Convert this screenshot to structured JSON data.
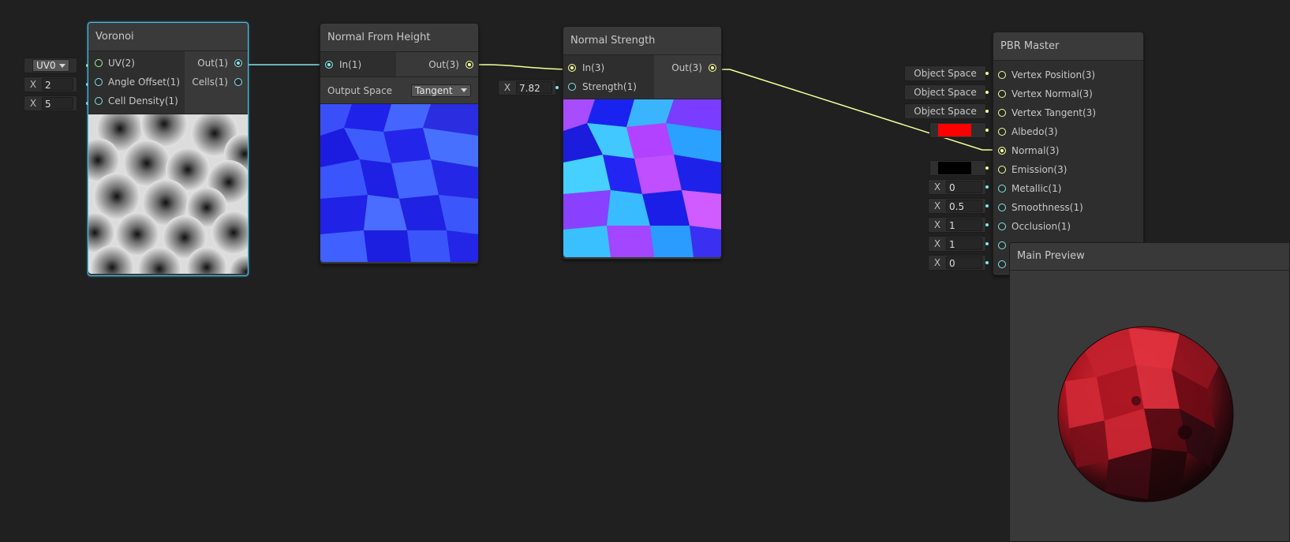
{
  "colors": {
    "background": "#202020",
    "node_body": "#393939",
    "selection": "#44c0e8",
    "wire_vector1": "#84e4e7",
    "wire_vector3": "#f6ff9a",
    "albedo": "#ff0000",
    "emission": "#000000"
  },
  "voronoi": {
    "title": "Voronoi",
    "inputs": [
      {
        "label": "UV(2)",
        "icon": "port-green"
      },
      {
        "label": "Angle Offset(1)",
        "icon": "port-cyan"
      },
      {
        "label": "Cell Density(1)",
        "icon": "port-cyan"
      }
    ],
    "outputs": [
      {
        "label": "Out(1)",
        "icon": "port-cyan-connected"
      },
      {
        "label": "Cells(1)",
        "icon": "port-cyan"
      }
    ],
    "uv_field": "UV0",
    "angle_offset": {
      "label": "X",
      "value": "2"
    },
    "cell_density": {
      "label": "X",
      "value": "5"
    }
  },
  "normal_from_height": {
    "title": "Normal From Height",
    "input": "In(1)",
    "output": "Out(3)",
    "output_space_label": "Output Space",
    "output_space_value": "Tangent"
  },
  "normal_strength": {
    "title": "Normal Strength",
    "inputs": [
      "In(3)",
      "Strength(1)"
    ],
    "output": "Out(3)",
    "strength_field": {
      "label": "X",
      "value": "7.82"
    }
  },
  "pbr_master": {
    "title": "PBR Master",
    "ports": [
      "Vertex Position(3)",
      "Vertex Normal(3)",
      "Vertex Tangent(3)",
      "Albedo(3)",
      "Normal(3)",
      "Emission(3)",
      "Metallic(1)",
      "Smoothness(1)",
      "Occlusion(1)"
    ],
    "space_fields": [
      "Object Space",
      "Object Space",
      "Object Space"
    ],
    "number_fields": [
      {
        "label": "X",
        "value": "0"
      },
      {
        "label": "X",
        "value": "0.5"
      },
      {
        "label": "X",
        "value": "1"
      },
      {
        "label": "X",
        "value": "1"
      },
      {
        "label": "X",
        "value": "0"
      }
    ]
  },
  "main_preview": {
    "title": "Main Preview"
  }
}
